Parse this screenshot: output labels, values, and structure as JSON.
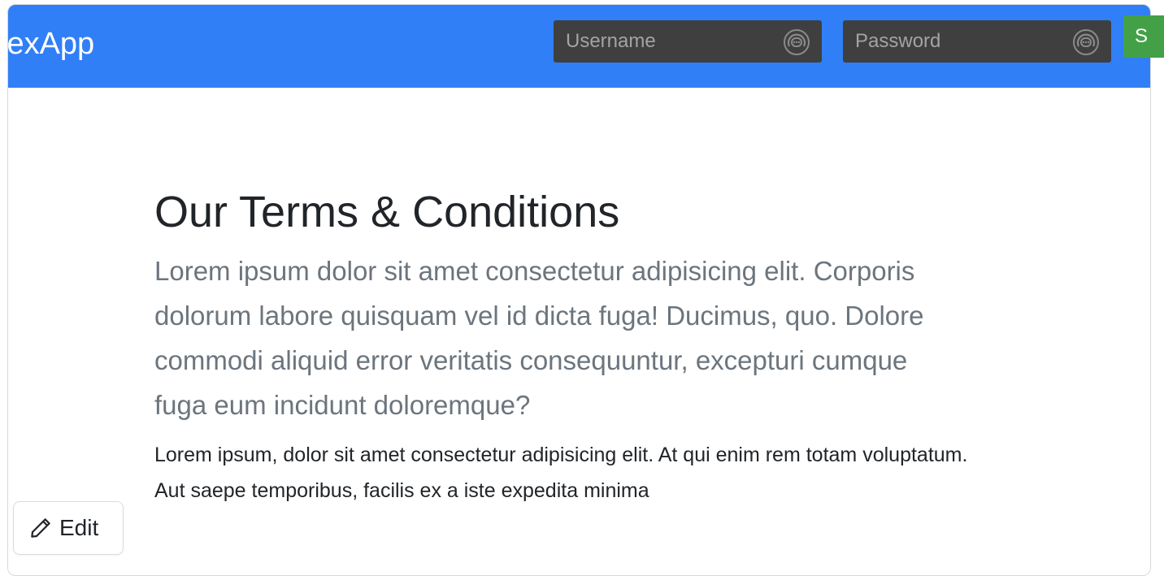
{
  "navbar": {
    "brand": "lexApp",
    "username_placeholder": "Username",
    "password_placeholder": "Password",
    "submit_label": "S",
    "field_icon": "password-manager-icon",
    "colors": {
      "navbar_bg": "#307ff7",
      "field_bg": "#3f3f3f",
      "submit_bg": "#43a047"
    }
  },
  "main": {
    "title": "Our Terms & Conditions",
    "lead": "Lorem ipsum dolor sit amet consectetur adipisicing elit. Corporis dolorum labore quisquam vel id dicta fuga! Ducimus, quo. Dolore commodi aliquid error veritatis consequuntur, excepturi cumque fuga eum incidunt doloremque?",
    "body": "Lorem ipsum, dolor sit amet consectetur adipisicing elit. At qui enim rem totam voluptatum. Aut saepe temporibus, facilis ex a iste expedita minima"
  },
  "edit_button": {
    "label": "Edit",
    "icon": "pencil-icon"
  }
}
